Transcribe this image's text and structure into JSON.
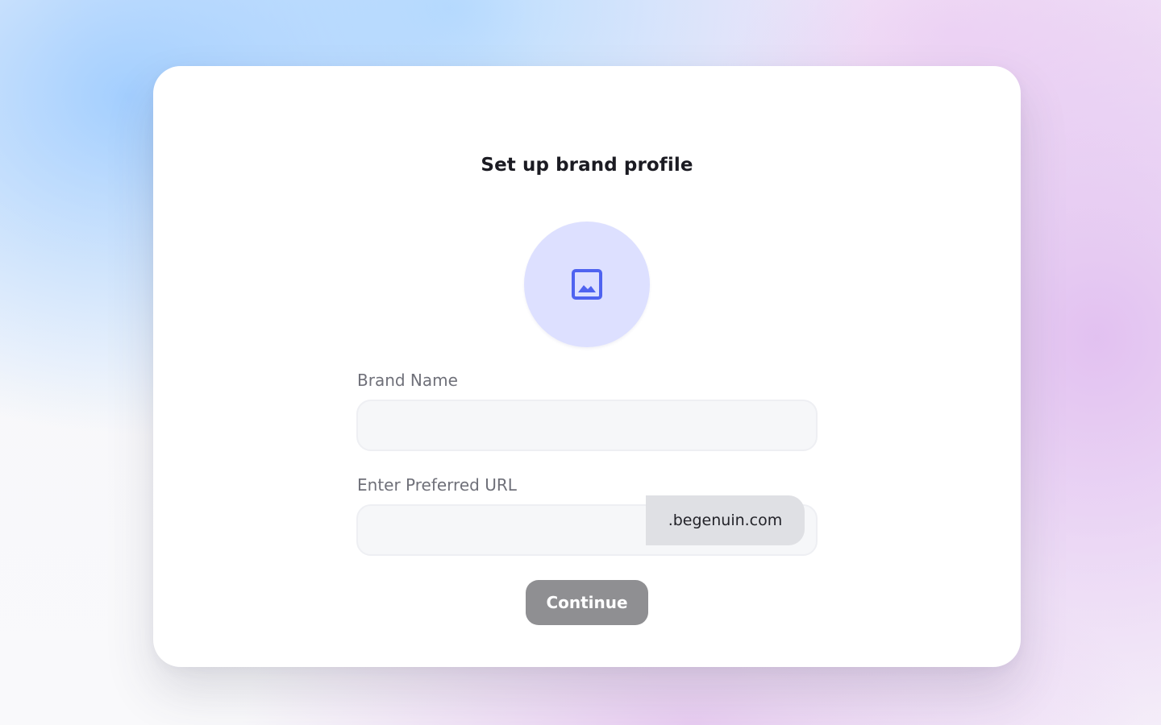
{
  "page": {
    "title": "Set up brand profile"
  },
  "avatar": {
    "icon": "image-icon",
    "bg_color": "#dde0ff",
    "icon_color": "#4f63f0"
  },
  "brand_name": {
    "label": "Brand Name",
    "value": "",
    "placeholder": ""
  },
  "preferred_url": {
    "label": "Enter Preferred URL",
    "value": "",
    "placeholder": "",
    "suffix": ".begenuin.com"
  },
  "continue_button": {
    "label": "Continue",
    "color": "#8f8f92",
    "disabled": true
  }
}
